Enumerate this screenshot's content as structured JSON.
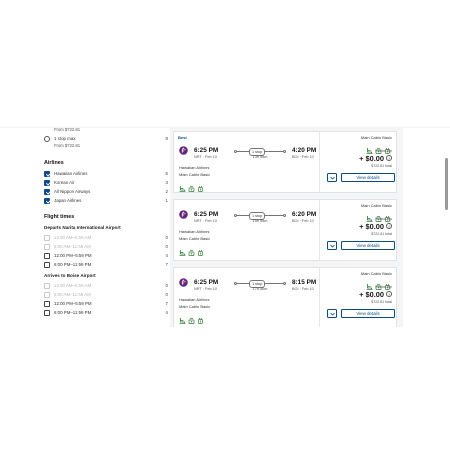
{
  "sidebar": {
    "stops_partial_price": "From $722.81",
    "stops_option": {
      "label": "1 stop max",
      "count": "8",
      "price": "From $722.81"
    },
    "airlines": {
      "heading": "Airlines",
      "items": [
        {
          "label": "Hawaiian Airlines",
          "count": "5",
          "checked": true
        },
        {
          "label": "Korean Air",
          "count": "3",
          "checked": true
        },
        {
          "label": "All Nippon Airways",
          "count": "2",
          "checked": true
        },
        {
          "label": "Japan Airlines",
          "count": "1",
          "checked": true
        }
      ]
    },
    "flight_times": {
      "heading": "Flight times",
      "depart_heading": "Departs Narita International Airport",
      "depart_items": [
        {
          "label": "12:00 AM–5:59 AM",
          "count": "0",
          "disabled": true
        },
        {
          "label": "6:00 AM–11:59 AM",
          "count": "0",
          "disabled": true
        },
        {
          "label": "12:00 PM–5:59 PM",
          "count": "4",
          "disabled": false
        },
        {
          "label": "6:00 PM–11:59 PM",
          "count": "7",
          "disabled": false
        }
      ],
      "arrive_heading": "Arrives to Boise Airport",
      "arrive_items": [
        {
          "label": "12:00 AM–5:59 AM",
          "count": "0",
          "disabled": true
        },
        {
          "label": "6:00 AM–11:59 AM",
          "count": "0",
          "disabled": true
        },
        {
          "label": "12:00 PM–5:59 PM",
          "count": "7",
          "disabled": false
        },
        {
          "label": "6:00 PM–11:59 PM",
          "count": "4",
          "disabled": false
        }
      ]
    }
  },
  "results": [
    {
      "badge": "Best",
      "depart_time": "6:25 PM",
      "depart_airport": "NRT · Feb 10",
      "arrive_time": "4:20 PM",
      "arrive_airport": "BOI · Feb 10",
      "stops": "1 stop",
      "duration": "13h 55m",
      "airline": "Hawaiian Airlines",
      "cabin": "Main Cabin Basic",
      "fare_cabin": "Main Cabin Basic",
      "trip_type": "Round-trip",
      "price": "+ $0.00",
      "total": "$722.81 total",
      "view_label": "View details"
    },
    {
      "badge": "",
      "depart_time": "6:25 PM",
      "depart_airport": "NRT · Feb 10",
      "arrive_time": "6:20 PM",
      "arrive_airport": "BOI · Feb 10",
      "stops": "1 stop",
      "duration": "15h 55m",
      "airline": "Hawaiian Airlines",
      "cabin": "Main Cabin Basic",
      "fare_cabin": "Main Cabin Basic",
      "trip_type": "Round-trip",
      "price": "+ $0.00",
      "total": "$722.81 total",
      "view_label": "View details"
    },
    {
      "badge": "",
      "depart_time": "6:25 PM",
      "depart_airport": "NRT · Feb 10",
      "arrive_time": "8:15 PM",
      "arrive_airport": "BOI · Feb 10",
      "stops": "1 stop",
      "duration": "17h 50m",
      "airline": "Hawaiian Airlines",
      "cabin": "Main Cabin Basic",
      "fare_cabin": "Main Cabin Basic",
      "trip_type": "Round-trip",
      "price": "+ $0.00",
      "total": "$722.81 total",
      "view_label": "View details"
    }
  ],
  "colors": {
    "accent": "#0b4a8b",
    "logo": "#5b2a86",
    "logo_accent": "#d1254b",
    "amenity": "#2e7d32"
  },
  "icons": {
    "logo": "hawaiian-airlines-logo-icon",
    "amenities": [
      "seat-icon",
      "wifi-icon",
      "power-icon"
    ],
    "expand": "chevron-down-icon",
    "info": "info-icon"
  }
}
